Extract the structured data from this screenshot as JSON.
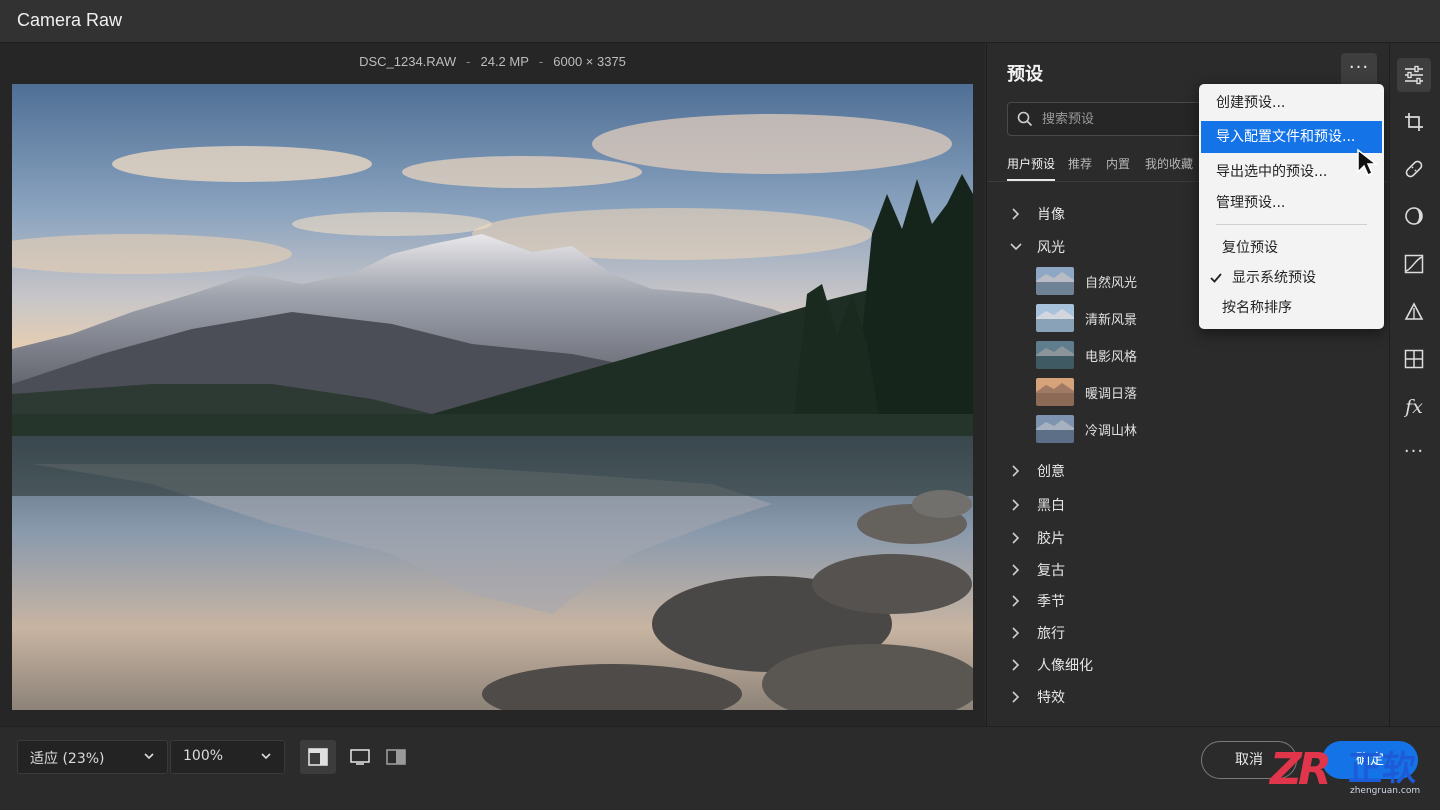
{
  "window": {
    "title": "Camera Raw"
  },
  "file": {
    "name": "DSC_1234.RAW",
    "megapixels": "24.2 MP",
    "dimensions": "6000 × 3375",
    "separator": "-"
  },
  "footer": {
    "fit_zoom": "适应 (23%)",
    "zoom_level": "100%",
    "view_modes": [
      "single-view",
      "full-screen",
      "before-after"
    ],
    "cancel_label": "取消",
    "ok_label": "确定"
  },
  "watermark": {
    "logo": "ZR",
    "text": "正软",
    "url": "zhengruan.com"
  },
  "presets_panel": {
    "title": "预设",
    "more_label": "···",
    "search_placeholder": "搜索预设",
    "tabs": [
      "用户预设",
      "推荐",
      "内置",
      "我的收藏"
    ],
    "active_tab": "用户预设",
    "groups": [
      {
        "label": "肖像",
        "expanded": false
      },
      {
        "label": "风光",
        "expanded": true,
        "items": [
          "自然风光",
          "清新风景",
          "电影风格",
          "暖调日落",
          "冷调山林"
        ]
      },
      {
        "label": "创意",
        "expanded": false
      },
      {
        "label": "黑白",
        "expanded": false
      },
      {
        "label": "胶片",
        "expanded": false
      },
      {
        "label": "复古",
        "expanded": false
      },
      {
        "label": "季节",
        "expanded": false
      },
      {
        "label": "旅行",
        "expanded": false
      },
      {
        "label": "人像细化",
        "expanded": false
      },
      {
        "label": "特效",
        "expanded": false
      }
    ]
  },
  "context_menu": {
    "items": [
      {
        "label": "创建预设..."
      },
      {
        "label": "导入配置文件和预设...",
        "highlighted": true
      },
      {
        "label": "导出选中的预设..."
      },
      {
        "label": "管理预设..."
      },
      {
        "label": "复位预设"
      },
      {
        "label": "显示系统预设",
        "checked": true
      },
      {
        "label": "按名称排序"
      }
    ]
  },
  "tool_rail": {
    "tools": [
      "edit-sliders-icon",
      "crop-icon",
      "healing-icon",
      "mask-icon",
      "curve-icon",
      "red-eye-icon",
      "grid-presets-icon",
      "fx-icon",
      "more-icon"
    ],
    "fx_label": "fx",
    "more_label": "···"
  },
  "colors": {
    "accent": "#1473e6",
    "panel_bg": "#2b2b2b",
    "menu_bg": "#f3f3f3"
  }
}
